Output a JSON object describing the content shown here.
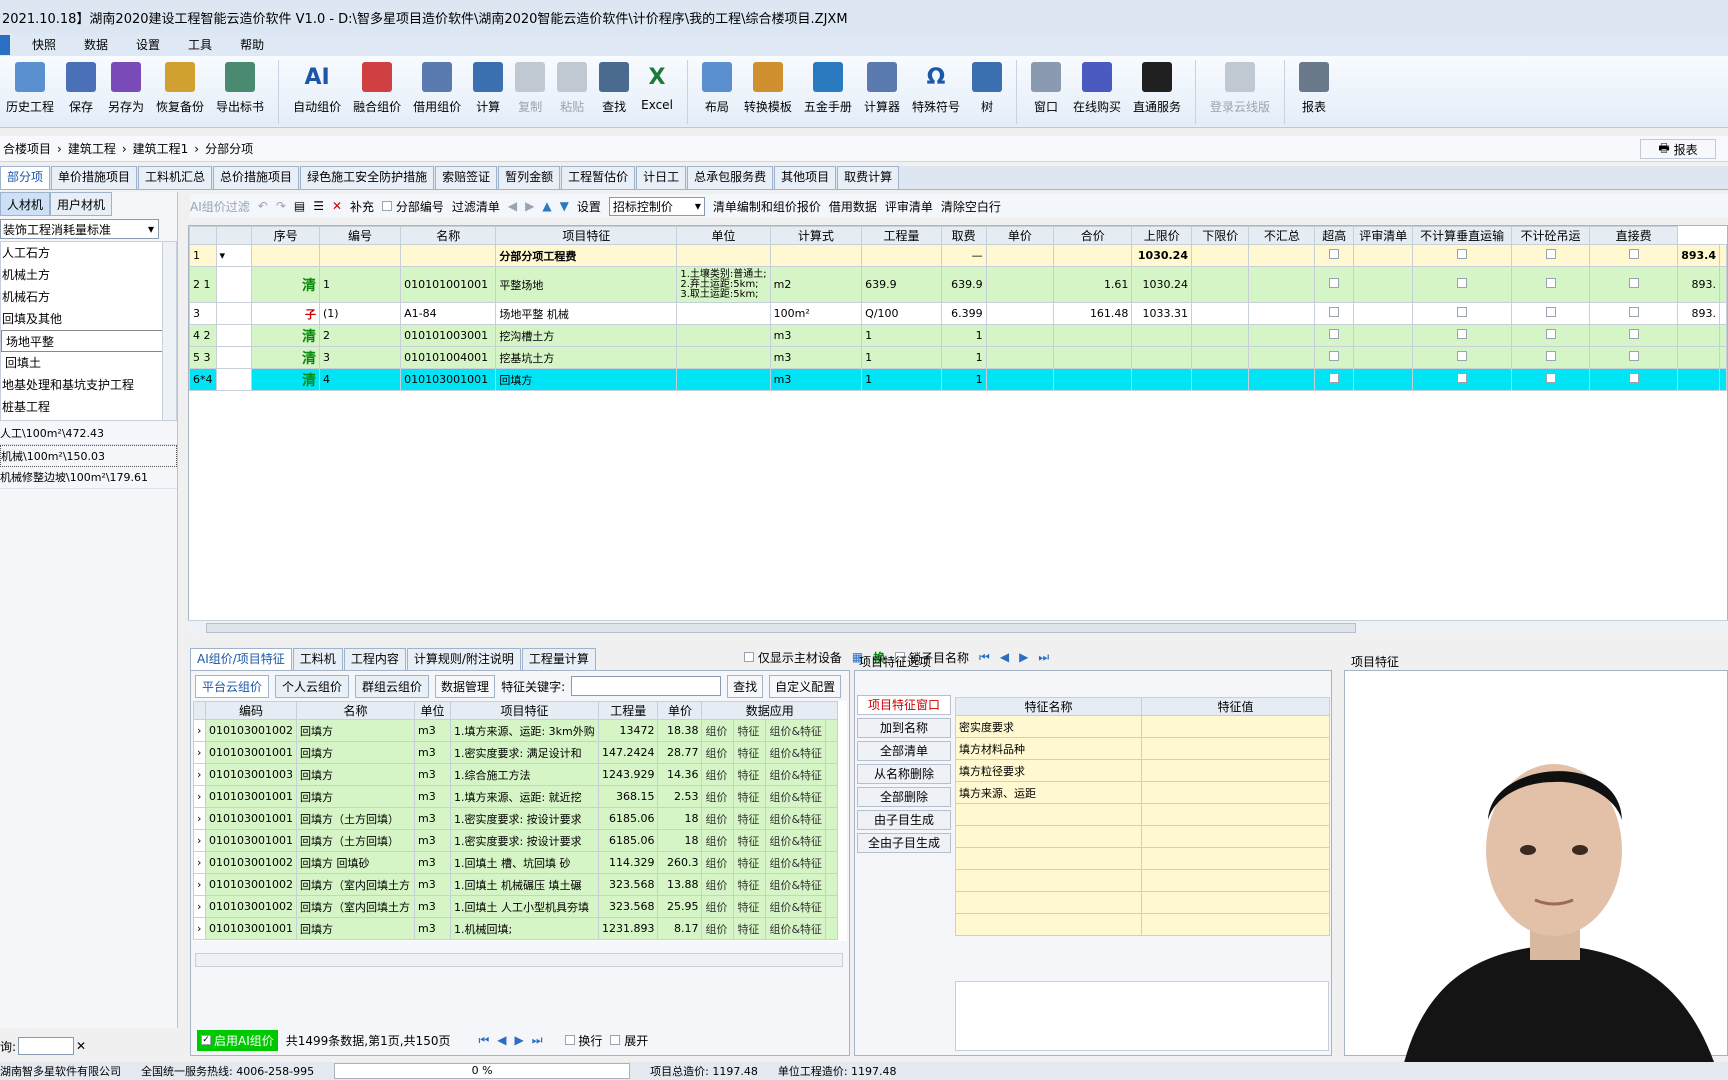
{
  "title": "2021.10.18】湖南2020建设工程智能云造价软件 V1.0 - D:\\智多星项目造价软件\\湖南2020智能云造价软件\\计价程序\\我的工程\\综合楼项目.ZJXM",
  "menu": [
    "快照",
    "数据",
    "设置",
    "工具",
    "帮助"
  ],
  "ribbon": [
    {
      "label": "历史工程",
      "icon": "history-icon",
      "color": "#5a8fd0"
    },
    {
      "label": "保存",
      "icon": "save-icon",
      "color": "#4a70b8"
    },
    {
      "label": "另存为",
      "icon": "save-as-icon",
      "color": "#7a4ab8"
    },
    {
      "label": "恢复备份",
      "icon": "restore-icon",
      "color": "#d0a030"
    },
    {
      "label": "导出标书",
      "icon": "export-icon",
      "color": "#4a8a70"
    },
    {
      "label": "自动组价",
      "icon": "ai-icon",
      "color": "#1b57a8",
      "text": "AI"
    },
    {
      "label": "融合组价",
      "icon": "merge-icon",
      "color": "#d04040"
    },
    {
      "label": "借用组价",
      "icon": "borrow-icon",
      "color": "#5a7ab0"
    },
    {
      "label": "计算",
      "icon": "computer-icon",
      "color": "#3a6fb0"
    },
    {
      "label": "复制",
      "icon": "copy-icon",
      "color": "#c0c8d2",
      "disabled": true
    },
    {
      "label": "粘贴",
      "icon": "paste-icon",
      "color": "#c0c8d2",
      "disabled": true
    },
    {
      "label": "查找",
      "icon": "find-icon",
      "color": "#4a6a90"
    },
    {
      "label": "Excel",
      "icon": "excel-icon",
      "color": "#1e7a3a",
      "text": "X"
    },
    {
      "label": "布局",
      "icon": "layout-icon",
      "color": "#5a8fd0"
    },
    {
      "label": "转换模板",
      "icon": "template-icon",
      "color": "#d09030"
    },
    {
      "label": "五金手册",
      "icon": "manual-icon",
      "color": "#2a7ac0"
    },
    {
      "label": "计算器",
      "icon": "calculator-icon",
      "color": "#5a7ab0"
    },
    {
      "label": "特殊符号",
      "icon": "omega-icon",
      "color": "#1b57a8",
      "text": "Ω"
    },
    {
      "label": "树",
      "icon": "tree-icon",
      "color": "#3a6fb0"
    },
    {
      "label": "窗口",
      "icon": "window-icon",
      "color": "#8a9ab0"
    },
    {
      "label": "在线购买",
      "icon": "usb-key-icon",
      "color": "#4a5ac0"
    },
    {
      "label": "直通服务",
      "icon": "qq-icon",
      "color": "#202020"
    },
    {
      "label": "登录云线版",
      "icon": "cloud-icon",
      "color": "#c0c8d2",
      "disabled": true
    },
    {
      "label": "报表",
      "icon": "printer-icon",
      "color": "#6a7a8a"
    }
  ],
  "breadcrumb": [
    "合楼项目",
    "建筑工程",
    "建筑工程1",
    "分部分项"
  ],
  "report_label": "报表",
  "tabs": [
    "部分项",
    "单价措施项目",
    "工料机汇总",
    "总价措施项目",
    "绿色施工安全防护措施",
    "索赔签证",
    "暂列金额",
    "工程暂估价",
    "计日工",
    "总承包服务费",
    "其他项目",
    "取费计算"
  ],
  "left": {
    "tabs": [
      "人材机",
      "用户材机"
    ],
    "select": "装饰工程消耗量标准",
    "tree": [
      "人工石方",
      "机械土方",
      "机械石方",
      "回填及其他",
      "场地平整",
      "回填土",
      "地基处理和基坑支护工程",
      "桩基工程"
    ],
    "list": [
      "人工\\100m²\\472.43",
      "机械\\100m²\\150.03",
      "机械修整边坡\\100m²\\179.61"
    ],
    "bottom_label": "询:"
  },
  "toolbar2": {
    "ai_filter": "AI组价过滤",
    "supplement": "补充",
    "part_code": "分部编号",
    "filter_list": "过滤清单",
    "settings": "设置",
    "combo": "招标控制价",
    "list_edit": "清单编制和组价报价",
    "borrow_data": "借用数据",
    "review_list": "评审清单",
    "clear_blank": "清除空白行"
  },
  "grid": {
    "headers": [
      "序号",
      "编号",
      "名称",
      "项目特征",
      "单位",
      "计算式",
      "工程量",
      "取费",
      "单价",
      "合价",
      "上限价",
      "下限价",
      "不汇总",
      "超高",
      "评审清单",
      "不计算垂直运输",
      "不计砼吊运",
      "直接费"
    ],
    "rows": [
      {
        "rowhead": "1",
        "type": "",
        "seq": "",
        "code": "",
        "name": "分部分项工程费",
        "feature": "",
        "unit": "",
        "formula": "",
        "qty": "—",
        "price": "",
        "total": "1030.24",
        "direct": "893.4",
        "style": "yellow"
      },
      {
        "rowhead": "2 1",
        "type": "清",
        "seq": "1",
        "code": "010101001001",
        "name": "平整场地",
        "feature": "1.土壤类别:普通土;\n2.弃土运距:5km;\n3.取土运距:5km;",
        "unit": "m2",
        "formula": "639.9",
        "qty": "639.9",
        "price": "1.61",
        "total": "1030.24",
        "direct": "893.",
        "style": "green"
      },
      {
        "rowhead": "3",
        "type": "子",
        "seq": "(1)",
        "code": "A1-84",
        "name": "场地平整 机械",
        "feature": "",
        "unit": "100m²",
        "formula": "Q/100",
        "qty": "6.399",
        "price": "161.48",
        "total": "1033.31",
        "direct": "893.",
        "style": "white"
      },
      {
        "rowhead": "4 2",
        "type": "清",
        "seq": "2",
        "code": "010101003001",
        "name": "挖沟槽土方",
        "feature": "",
        "unit": "m3",
        "formula": "1",
        "qty": "1",
        "price": "",
        "total": "",
        "direct": "",
        "style": "green"
      },
      {
        "rowhead": "5 3",
        "type": "清",
        "seq": "3",
        "code": "010101004001",
        "name": "挖基坑土方",
        "feature": "",
        "unit": "m3",
        "formula": "1",
        "qty": "1",
        "price": "",
        "total": "",
        "direct": "",
        "style": "green"
      },
      {
        "rowhead": "6*4",
        "type": "清",
        "seq": "4",
        "code": "010103001001",
        "name": "回填方",
        "feature": "",
        "unit": "m3",
        "formula": "1",
        "qty": "1",
        "price": "",
        "total": "",
        "direct": "",
        "style": "cyan"
      }
    ]
  },
  "bottom_tabs": [
    "AI组价/项目特征",
    "工料机",
    "工程内容",
    "计算规则/附注说明",
    "工程量计算"
  ],
  "bottom_right": {
    "only_main": "仅显示主材设备",
    "swap": "换",
    "lock_name": "锁子目名称"
  },
  "ai": {
    "subtabs": [
      "平台云组价",
      "个人云组价",
      "群组云组价"
    ],
    "data_mgmt": "数据管理",
    "keyword_label": "特征关键字:",
    "search": "查找",
    "custom": "自定义配置",
    "headers": [
      "编码",
      "名称",
      "单位",
      "项目特征",
      "工程量",
      "单价",
      "数据应用"
    ],
    "rows": [
      {
        "code": "010103001002",
        "name": "回填方",
        "unit": "m3",
        "feat": "1.填方来源、运距: 3km外购",
        "qty": "13472",
        "price": "18.38"
      },
      {
        "code": "010103001001",
        "name": "回填方",
        "unit": "m3",
        "feat": "1.密实度要求: 满足设计和",
        "qty": "147.2424",
        "price": "28.77"
      },
      {
        "code": "010103001003",
        "name": "回填方",
        "unit": "m3",
        "feat": "1.综合施工方法",
        "qty": "1243.929",
        "price": "14.36"
      },
      {
        "code": "010103001001",
        "name": "回填方",
        "unit": "m3",
        "feat": "1.填方来源、运距: 就近挖",
        "qty": "368.15",
        "price": "2.53"
      },
      {
        "code": "010103001001",
        "name": "回填方（土方回填）",
        "unit": "m3",
        "feat": "1.密实度要求: 按设计要求",
        "qty": "6185.06",
        "price": "18"
      },
      {
        "code": "010103001001",
        "name": "回填方（土方回填）",
        "unit": "m3",
        "feat": "1.密实度要求: 按设计要求",
        "qty": "6185.06",
        "price": "18"
      },
      {
        "code": "010103001002",
        "name": "回填方 回填砂",
        "unit": "m3",
        "feat": "1.回填土 槽、坑回填 砂",
        "qty": "114.329",
        "price": "260.3"
      },
      {
        "code": "010103001002",
        "name": "回填方（室内回填土方",
        "unit": "m3",
        "feat": "1.回填土 机械碾压 填土碾",
        "qty": "323.568",
        "price": "13.88"
      },
      {
        "code": "010103001002",
        "name": "回填方（室内回填土方",
        "unit": "m3",
        "feat": "1.回填土 人工小型机具夯填",
        "qty": "323.568",
        "price": "25.95"
      },
      {
        "code": "010103001001",
        "name": "回填方",
        "unit": "m3",
        "feat": "1.机械回填;",
        "qty": "1231.893",
        "price": "8.17"
      }
    ],
    "actions": [
      "组价",
      "特征",
      "组价&特征"
    ],
    "enable": "启用AI组价",
    "summary": "共1499条数据,第1页,共150页",
    "wrap": "换行",
    "expand": "展开"
  },
  "feature_options": {
    "header": "项目特征选项",
    "buttons": [
      "项目特征窗口",
      "加到名称",
      "全部清单",
      "从名称删除",
      "全部删除",
      "由子目生成",
      "全由子目生成"
    ],
    "headers": [
      "特征名称",
      "特征值"
    ],
    "rows": [
      "密实度要求",
      "填方材料品种",
      "填方粒径要求",
      "填方来源、运距",
      "",
      "",
      "",
      "",
      "",
      ""
    ]
  },
  "right_header": "项目特征",
  "status": {
    "company": "湖南智多星软件有限公司",
    "hotline": "全国统一服务热线: 4006-258-995",
    "progress": "0 %",
    "project_total": "项目总造价: 1197.48",
    "unit_total": "单位工程造价: 1197.48"
  }
}
